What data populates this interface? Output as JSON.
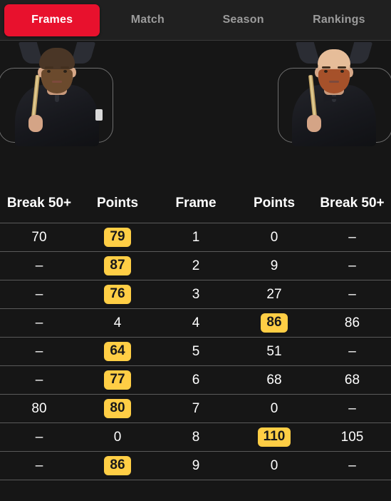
{
  "tabs": [
    {
      "label": "Frames",
      "active": true
    },
    {
      "label": "Match",
      "active": false
    },
    {
      "label": "Season",
      "active": false
    },
    {
      "label": "Rankings",
      "active": false
    }
  ],
  "players": {
    "left": {
      "photo_alt": "snooker-player-left",
      "holding": "cue"
    },
    "right": {
      "photo_alt": "snooker-player-right",
      "holding": "cue"
    }
  },
  "table": {
    "headers": [
      "Break 50+",
      "Points",
      "Frame",
      "Points",
      "Break 50+"
    ],
    "rows": [
      {
        "left_break": "70",
        "left_points": "79",
        "left_highlight": true,
        "frame": "1",
        "right_points": "0",
        "right_highlight": false,
        "right_break": "–"
      },
      {
        "left_break": "–",
        "left_points": "87",
        "left_highlight": true,
        "frame": "2",
        "right_points": "9",
        "right_highlight": false,
        "right_break": "–"
      },
      {
        "left_break": "–",
        "left_points": "76",
        "left_highlight": true,
        "frame": "3",
        "right_points": "27",
        "right_highlight": false,
        "right_break": "–"
      },
      {
        "left_break": "–",
        "left_points": "4",
        "left_highlight": false,
        "frame": "4",
        "right_points": "86",
        "right_highlight": true,
        "right_break": "86"
      },
      {
        "left_break": "–",
        "left_points": "64",
        "left_highlight": true,
        "frame": "5",
        "right_points": "51",
        "right_highlight": false,
        "right_break": "–"
      },
      {
        "left_break": "–",
        "left_points": "77",
        "left_highlight": true,
        "frame": "6",
        "right_points": "68",
        "right_highlight": false,
        "right_break": "68"
      },
      {
        "left_break": "80",
        "left_points": "80",
        "left_highlight": true,
        "frame": "7",
        "right_points": "0",
        "right_highlight": false,
        "right_break": "–"
      },
      {
        "left_break": "–",
        "left_points": "0",
        "left_highlight": false,
        "frame": "8",
        "right_points": "110",
        "right_highlight": true,
        "right_break": "105"
      },
      {
        "left_break": "–",
        "left_points": "86",
        "left_highlight": true,
        "frame": "9",
        "right_points": "0",
        "right_highlight": false,
        "right_break": "–"
      }
    ]
  },
  "colors": {
    "page_background": "#161616",
    "tabbar_background": "#202020",
    "active_tab": "#e8112d",
    "inactive_tab_text": "#9b9b9b",
    "badge_background": "#ffce45",
    "badge_text": "#18181a",
    "row_divider": "#5a5a5a",
    "text": "#ffffff"
  }
}
